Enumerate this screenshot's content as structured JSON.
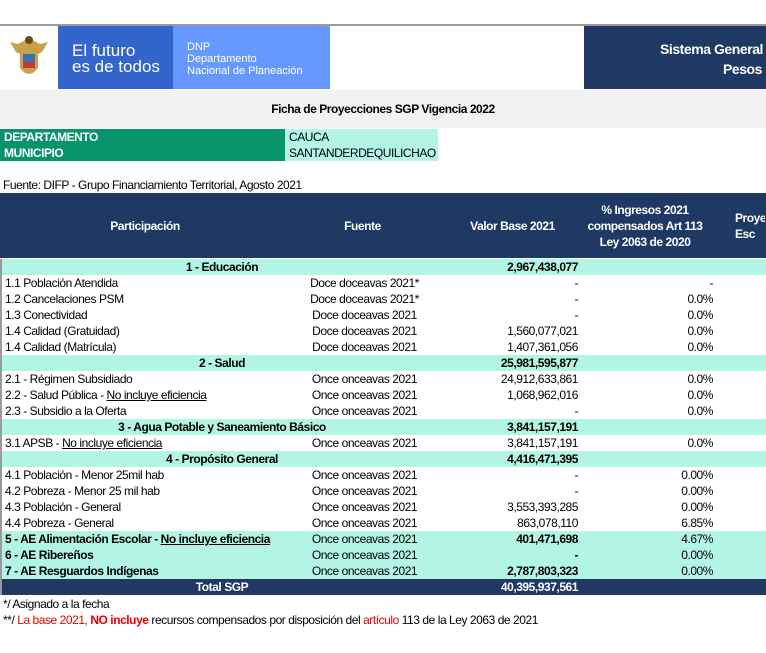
{
  "header": {
    "logo_left": "El futuro",
    "logo_right": "es de todos",
    "dnp": "DNP",
    "dnp_line1": "Departamento",
    "dnp_line2": "Nacional de Planeación",
    "title_line1": "Sistema General",
    "title_line2": "Pesos"
  },
  "title": "Ficha de Proyecciones SGP Vigencia 2022",
  "info": {
    "dept_label": "DEPARTAMENTO",
    "dept_value": "CAUCA",
    "mun_label": "MUNICIPIO",
    "mun_value": "SANTANDERDEQUILICHAO"
  },
  "source": "Fuente: DIFP - Grupo Financiamiento Territorial, Agosto 2021",
  "columns": [
    "Participación",
    "Fuente",
    "Valor Base 2021",
    "% Ingresos 2021 compensados Art 113 Ley 2063 de 2020",
    "Proye Esc"
  ],
  "colors": {
    "navy": "#203864",
    "mint": "#b3f5e3",
    "green": "#079469",
    "blue": "#3366cc",
    "light_blue": "#6699ff"
  },
  "rows": [
    {
      "type": "group",
      "label": "1 - Educación",
      "value": "2,967,438,077"
    },
    {
      "type": "item",
      "label": "1.1 Población Atendida",
      "fuente": "Doce doceavas 2021*",
      "value": "-",
      "pct": "-"
    },
    {
      "type": "item",
      "label": "1.2 Cancelaciones PSM",
      "fuente": "Doce doceavas 2021*",
      "value": "-",
      "pct": "0.0%"
    },
    {
      "type": "item",
      "label": "1.3 Conectividad",
      "fuente": "Doce doceavas 2021",
      "value": "-",
      "pct": "0.0%"
    },
    {
      "type": "item",
      "label": "1.4 Calidad (Gratuidad)",
      "fuente": "Doce doceavas 2021",
      "value": "1,560,077,021",
      "pct": "0.0%"
    },
    {
      "type": "item",
      "label": "1.4 Calidad (Matrícula)",
      "fuente": "Doce doceavas 2021",
      "value": "1,407,361,056",
      "pct": "0.0%"
    },
    {
      "type": "group",
      "label": "2 - Salud",
      "value": "25,981,595,877"
    },
    {
      "type": "item",
      "label": "2.1 - Régimen Subsidiado",
      "fuente": "Once onceavas 2021",
      "value": "24,912,633,861",
      "pct": "0.0%"
    },
    {
      "type": "item",
      "label": "2.2 - Salud Pública - ",
      "ul": "No incluye eficiencia",
      "fuente": "Once onceavas 2021",
      "value": "1,068,962,016",
      "pct": "0.0%"
    },
    {
      "type": "item",
      "label": "2.3 - Subsidio a la Oferta",
      "fuente": "Once onceavas 2021",
      "value": "-",
      "pct": "0.0%"
    },
    {
      "type": "group",
      "label": "3 - Agua Potable y Saneamiento Básico",
      "value": "3,841,157,191"
    },
    {
      "type": "item",
      "label": "3.1 APSB - ",
      "ul": "No incluye eficiencia",
      "fuente": "Once onceavas 2021",
      "value": "3,841,157,191",
      "pct": "0.0%"
    },
    {
      "type": "group",
      "label": "4 - Propósito General",
      "value": "4,416,471,395"
    },
    {
      "type": "item",
      "label": "4.1 Población - Menor 25mil hab",
      "fuente": "Once onceavas 2021",
      "value": "-",
      "pct": "0.00%"
    },
    {
      "type": "item",
      "label": "4.2 Pobreza - Menor 25 mil hab",
      "fuente": "Once onceavas 2021",
      "value": "-",
      "pct": "0.00%"
    },
    {
      "type": "item",
      "label": "4.3 Población - General",
      "fuente": "Once onceavas 2021",
      "value": "3,553,393,285",
      "pct": "0.00%"
    },
    {
      "type": "item",
      "label": "4.4 Pobreza - General",
      "fuente": "Once onceavas 2021",
      "value": "863,078,110",
      "pct": "6.85%"
    },
    {
      "type": "ae",
      "label": "5 - AE Alimentación Escolar - ",
      "ul": "No incluye eficiencia",
      "fuente": "Once onceavas 2021",
      "value": "401,471,698",
      "pct": "4.67%"
    },
    {
      "type": "ae",
      "label": "6 - AE Ribereños",
      "fuente": "Once onceavas 2021",
      "value": "-",
      "pct": "0.00%"
    },
    {
      "type": "ae",
      "label": "7 - AE Resguardos Indígenas",
      "fuente": "Once onceavas 2021",
      "value": "2,787,803,323",
      "pct": "0.00%"
    },
    {
      "type": "total",
      "label": "Total SGP",
      "value": "40,395,937,561"
    }
  ],
  "notes": {
    "note1": "*/ Asignado a la fecha",
    "n2a": "**/ ",
    "n2b": "La base 2021, ",
    "n2c": "NO incluye",
    "n2d": " recursos compensados por disposición del ",
    "n2e": "artículo",
    "n2f": " 113 de la Ley 2063 de 2021"
  }
}
